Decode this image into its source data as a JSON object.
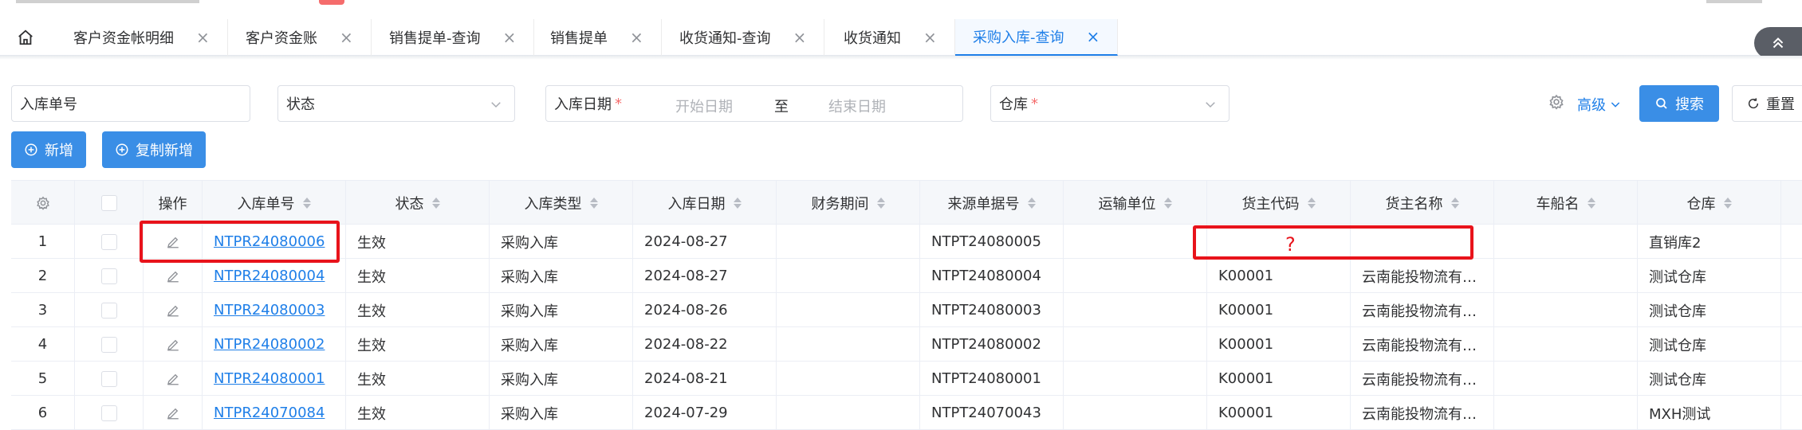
{
  "tabs": [
    {
      "label": "客户资金帐明细"
    },
    {
      "label": "客户资金账"
    },
    {
      "label": "销售提单-查询"
    },
    {
      "label": "销售提单"
    },
    {
      "label": "收货通知-查询"
    },
    {
      "label": "收货通知"
    },
    {
      "label": "采购入库-查询"
    }
  ],
  "active_tab": "采购入库-查询",
  "close_glyph": "×",
  "filters": {
    "order_no": "入库单号",
    "status": "状态",
    "date_label": "入库日期",
    "required": "*",
    "start_date": "开始日期",
    "date_sep": "至",
    "end_date": "结束日期",
    "warehouse": "仓库"
  },
  "actions": {
    "advanced": "高级",
    "search": "搜索",
    "reset": "重置",
    "add": "新增",
    "copy_add": "复制新增"
  },
  "table": {
    "headers": {
      "op": "操作",
      "order_no": "入库单号",
      "status": "状态",
      "type": "入库类型",
      "date": "入库日期",
      "period": "财务期间",
      "source_no": "来源单据号",
      "carrier": "运输单位",
      "owner_code": "货主代码",
      "owner_name": "货主名称",
      "ship": "车船名",
      "warehouse": "仓库"
    },
    "rows": [
      {
        "idx": "1",
        "order_no": "NTPR24080006",
        "status": "生效",
        "type": "采购入库",
        "date": "2024-08-27",
        "period": "",
        "source_no": "NTPT24080005",
        "carrier": "",
        "owner_code": "",
        "owner_name": "",
        "ship": "",
        "warehouse": "直销库2"
      },
      {
        "idx": "2",
        "order_no": "NTPR24080004",
        "status": "生效",
        "type": "采购入库",
        "date": "2024-08-27",
        "period": "",
        "source_no": "NTPT24080004",
        "carrier": "",
        "owner_code": "K00001",
        "owner_name": "云南能投物流有…",
        "ship": "",
        "warehouse": "测试仓库"
      },
      {
        "idx": "3",
        "order_no": "NTPR24080003",
        "status": "生效",
        "type": "采购入库",
        "date": "2024-08-26",
        "period": "",
        "source_no": "NTPT24080003",
        "carrier": "",
        "owner_code": "K00001",
        "owner_name": "云南能投物流有…",
        "ship": "",
        "warehouse": "测试仓库"
      },
      {
        "idx": "4",
        "order_no": "NTPR24080002",
        "status": "生效",
        "type": "采购入库",
        "date": "2024-08-22",
        "period": "",
        "source_no": "NTPT24080002",
        "carrier": "",
        "owner_code": "K00001",
        "owner_name": "云南能投物流有…",
        "ship": "",
        "warehouse": "测试仓库"
      },
      {
        "idx": "5",
        "order_no": "NTPR24080001",
        "status": "生效",
        "type": "采购入库",
        "date": "2024-08-21",
        "period": "",
        "source_no": "NTPT24080001",
        "carrier": "",
        "owner_code": "K00001",
        "owner_name": "云南能投物流有…",
        "ship": "",
        "warehouse": "测试仓库"
      },
      {
        "idx": "6",
        "order_no": "NTPR24070084",
        "status": "生效",
        "type": "采购入库",
        "date": "2024-07-29",
        "period": "",
        "source_no": "NTPT24070043",
        "carrier": "",
        "owner_code": "K00001",
        "owner_name": "云南能投物流有…",
        "ship": "",
        "warehouse": "MXH测试"
      }
    ]
  },
  "annotation": {
    "question": "?",
    "color": "#e8131b"
  },
  "accent": "#1f7fe8"
}
